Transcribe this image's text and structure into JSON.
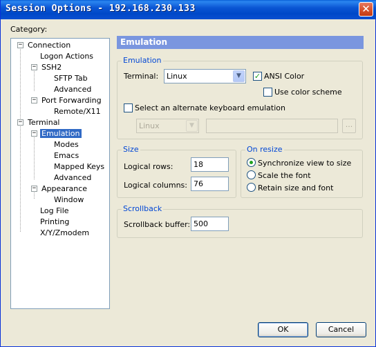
{
  "window": {
    "title": "Session Options - 192.168.230.133"
  },
  "category_label": "Category:",
  "tree": [
    {
      "label": "Connection",
      "expander": "minus",
      "selected": false
    },
    {
      "label": "Logon Actions"
    },
    {
      "label": "SSH2",
      "expander": "minus"
    },
    {
      "label": "SFTP Tab"
    },
    {
      "label": "Advanced"
    },
    {
      "label": "Port Forwarding",
      "expander": "minus"
    },
    {
      "label": "Remote/X11"
    },
    {
      "label": "Terminal",
      "expander": "minus"
    },
    {
      "label": "Emulation",
      "expander": "minus",
      "selected": true
    },
    {
      "label": "Modes"
    },
    {
      "label": "Emacs"
    },
    {
      "label": "Mapped Keys"
    },
    {
      "label": "Advanced"
    },
    {
      "label": "Appearance",
      "expander": "minus"
    },
    {
      "label": "Window"
    },
    {
      "label": "Log File"
    },
    {
      "label": "Printing"
    },
    {
      "label": "X/Y/Zmodem"
    }
  ],
  "panel": {
    "header": "Emulation",
    "emulation_group": {
      "title": "Emulation",
      "terminal_label": "Terminal:",
      "terminal_value": "Linux",
      "ansi_color_label": "ANSI Color",
      "ansi_color_checked": true,
      "use_color_scheme_label": "Use color scheme",
      "use_color_scheme_checked": false,
      "alt_keyboard_label": "Select an alternate keyboard emulation",
      "alt_keyboard_checked": false,
      "alt_keyboard_value": "Linux",
      "alt_keyboard_text": "",
      "browse_label": "..."
    },
    "size_group": {
      "title": "Size",
      "rows_label": "Logical rows:",
      "rows_value": "18",
      "columns_label": "Logical columns:",
      "columns_value": "76"
    },
    "resize_group": {
      "title": "On resize",
      "options": [
        {
          "label": "Synchronize view to size",
          "selected": true
        },
        {
          "label": "Scale the font",
          "selected": false
        },
        {
          "label": "Retain size and font",
          "selected": false
        }
      ]
    },
    "scrollback_group": {
      "title": "Scrollback",
      "buffer_label": "Scrollback buffer:",
      "buffer_value": "500"
    }
  },
  "buttons": {
    "ok": "OK",
    "cancel": "Cancel"
  },
  "colors": {
    "accent": "#7a96df",
    "selection": "#316ac5",
    "group_title": "#0046d5"
  }
}
